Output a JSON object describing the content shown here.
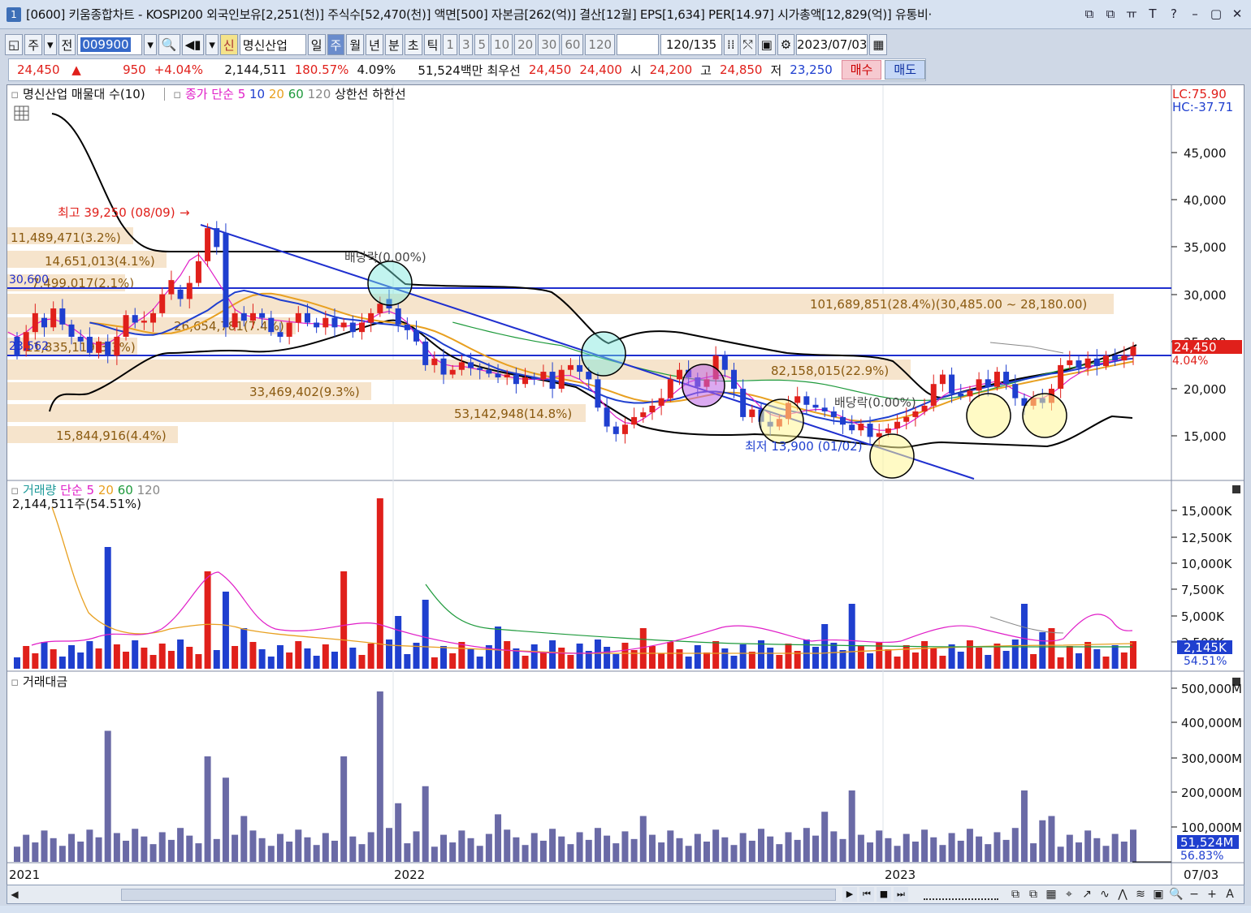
{
  "window": {
    "number": "1",
    "title": "[0600] 키움종합차트 - KOSPI200 외국인보유[2,251(천)] 주식수[52,470(천)] 액면[500] 자본금[262(억)] 결산[12월] EPS[1,634] PER[14.97] 시가총액[12,829(억)] 유통비·",
    "buttons": [
      "⧉",
      "⧉",
      "ㅠ",
      "T",
      "?",
      "–",
      "▢",
      "✕"
    ]
  },
  "toolbar": {
    "items": [
      "◱",
      "주",
      "▾",
      "전"
    ],
    "code": "009900",
    "after": [
      "▾",
      "🔍",
      "◀▮",
      "▾"
    ],
    "badge": "신",
    "name": "명신산업",
    "periods": [
      "일",
      "주",
      "월",
      "년",
      "분",
      "초",
      "틱"
    ],
    "selected_period": "주",
    "nums": [
      "1",
      "3",
      "5",
      "10",
      "20",
      "30",
      "60",
      "120"
    ],
    "count": "120/135",
    "date": "2023/07/03"
  },
  "quote": {
    "price": "24,450",
    "arrow": "▲",
    "change": "950",
    "pct": "+4.04%",
    "volume": "2,144,511",
    "vol_ratio": "180.57%",
    "turnover": "4.09%",
    "amount": "51,524백만",
    "best_label": "최우선",
    "best_ask": "24,450",
    "best_bid": "24,400",
    "open_label": "시",
    "open": "24,200",
    "high_label": "고",
    "high": "24,850",
    "low_label": "저",
    "low": "23,250",
    "buy": "매수",
    "sell": "매도"
  },
  "legend": {
    "main": "명신산업 매물대 수(10)",
    "ma_label": "종가 단순",
    "ma": [
      "5",
      "10",
      "20",
      "60",
      "120"
    ],
    "upper": "상한선",
    "lower": "하한선",
    "vol": "거래량",
    "vol_ma_label": "단순",
    "vol_ma": [
      "5",
      "20",
      "60",
      "120"
    ],
    "vol_info": "2,144,511주(54.51%)",
    "amt": "거래대금"
  },
  "colors": {
    "up": "#e0201b",
    "down": "#1f3fcf",
    "ma5": "#e01ec8",
    "ma10": "#1f3fcf",
    "ma20": "#e8a020",
    "ma60": "#1e9a3c",
    "ma120": "#888888",
    "band": "#000000",
    "vp": "#f6e4cc",
    "vp_text": "#8a5a10"
  },
  "price_axis": {
    "labels": [
      "45,000",
      "40,000",
      "35,000",
      "30,000",
      "25,000",
      "20,000",
      "15,000"
    ],
    "lc": "LC:75.90",
    "hc": "HC:-37.71",
    "last": "24,450",
    "last_pct": "4.04%"
  },
  "vol_axis": {
    "labels": [
      "15,000K",
      "12,500K",
      "10,000K",
      "7,500K",
      "5,000K",
      "2,500K"
    ],
    "last": "2,145K",
    "last_pct": "54.51%"
  },
  "amt_axis": {
    "labels": [
      "500,000M",
      "400,000M",
      "300,000M",
      "200,000M",
      "100,000M"
    ],
    "last": "51,524M",
    "last_pct": "56.83%"
  },
  "x_labels": {
    "y2021": "2021",
    "y2022": "2022",
    "y2023": "2023",
    "end": "07/03"
  },
  "volume_profile": [
    {
      "label": "11,489,471(3.2%)"
    },
    {
      "label": "14,651,013(4.1%)"
    },
    {
      "label": "7,499,017(2.1%)"
    },
    {
      "label": "101,689,851(28.4%)(30,485.00 ~ 28,180.00)"
    },
    {
      "label": "26,654,781(7.4%)"
    },
    {
      "label": "11,835,119(3.3%)"
    },
    {
      "label": "82,158,015(22.9%)"
    },
    {
      "label": "33,469,402(9.3%)"
    },
    {
      "label": "53,142,948(14.8%)"
    },
    {
      "label": "15,844,916(4.4%)"
    }
  ],
  "annotations": {
    "high": "최고 39,250 (08/09)",
    "high_arrow": "→",
    "low": "최저 13,900 (01/02)",
    "div1": "배당락(0.00%)",
    "div2": "배당락(0.00%)",
    "left_price1": "30,600",
    "left_price2": "23,562"
  },
  "chart_data": {
    "type": "candlestick",
    "title": "",
    "weeks": 135,
    "ylim": [
      10000,
      48000
    ],
    "candles": [
      [
        25500,
        23500
      ],
      [
        24000,
        26000
      ],
      [
        26000,
        28000
      ],
      [
        27500,
        26500
      ],
      [
        26500,
        28500
      ],
      [
        28500,
        26800
      ],
      [
        26800,
        25500
      ],
      [
        25500,
        25000
      ],
      [
        25500,
        23800
      ],
      [
        23800,
        25000
      ],
      [
        25000,
        23500
      ],
      [
        23500,
        25500
      ],
      [
        25500,
        27800
      ],
      [
        27800,
        27000
      ],
      [
        27000,
        27200
      ],
      [
        27000,
        28000
      ],
      [
        28000,
        30000
      ],
      [
        30000,
        31500
      ],
      [
        30500,
        29500
      ],
      [
        29500,
        31200
      ],
      [
        31200,
        33500
      ],
      [
        33500,
        37000
      ],
      [
        37000,
        35000
      ],
      [
        36500,
        26500
      ],
      [
        26500,
        28000
      ],
      [
        28000,
        27200
      ],
      [
        27200,
        28000
      ],
      [
        28000,
        27500
      ],
      [
        27500,
        26000
      ],
      [
        26000,
        25500
      ],
      [
        25500,
        27000
      ],
      [
        27000,
        28000
      ],
      [
        28000,
        27000
      ],
      [
        27000,
        26500
      ],
      [
        26500,
        27500
      ],
      [
        27500,
        26500
      ],
      [
        26500,
        27000
      ],
      [
        27000,
        26000
      ],
      [
        26000,
        27000
      ],
      [
        27000,
        28000
      ],
      [
        28000,
        29000
      ],
      [
        29500,
        28500
      ],
      [
        28500,
        26800
      ],
      [
        26800,
        26200
      ],
      [
        26200,
        25000
      ],
      [
        25000,
        22500
      ],
      [
        22500,
        23200
      ],
      [
        23200,
        21500
      ],
      [
        21500,
        22000
      ],
      [
        22000,
        22800
      ],
      [
        22800,
        22200
      ],
      [
        22200,
        22000
      ],
      [
        22000,
        21600
      ],
      [
        21600,
        21200
      ],
      [
        21200,
        21500
      ],
      [
        21500,
        20500
      ],
      [
        20500,
        21200
      ],
      [
        21200,
        21000
      ],
      [
        21000,
        21800
      ],
      [
        21800,
        20000
      ],
      [
        20000,
        22000
      ],
      [
        22000,
        22500
      ],
      [
        22500,
        21800
      ],
      [
        21800,
        21000
      ],
      [
        21000,
        18000
      ],
      [
        18000,
        16000
      ],
      [
        16000,
        15200
      ],
      [
        15200,
        16200
      ],
      [
        16200,
        17000
      ],
      [
        17000,
        17500
      ],
      [
        17500,
        18200
      ],
      [
        18200,
        19000
      ],
      [
        19000,
        21000
      ],
      [
        21000,
        22000
      ],
      [
        22000,
        21200
      ],
      [
        21200,
        20200
      ],
      [
        20200,
        21000
      ],
      [
        21000,
        23500
      ],
      [
        23500,
        22000
      ],
      [
        22000,
        20000
      ],
      [
        20000,
        17000
      ],
      [
        17000,
        17800
      ],
      [
        17800,
        16500
      ],
      [
        16500,
        16000
      ],
      [
        16000,
        16800
      ],
      [
        16800,
        18500
      ],
      [
        18500,
        19200
      ],
      [
        19200,
        18300
      ],
      [
        18300,
        18000
      ],
      [
        18000,
        17600
      ],
      [
        17600,
        17000
      ],
      [
        17000,
        16200
      ],
      [
        16200,
        15600
      ],
      [
        15600,
        16300
      ],
      [
        16300,
        14900
      ],
      [
        14900,
        15300
      ],
      [
        15300,
        15800
      ],
      [
        15800,
        16500
      ],
      [
        16500,
        17000
      ],
      [
        17000,
        17600
      ],
      [
        17600,
        18200
      ],
      [
        18200,
        20500
      ],
      [
        20500,
        21500
      ],
      [
        21500,
        19500
      ],
      [
        19500,
        19200
      ],
      [
        19200,
        19800
      ],
      [
        19800,
        21000
      ],
      [
        21000,
        20200
      ],
      [
        20200,
        21800
      ],
      [
        21800,
        20500
      ],
      [
        20500,
        19000
      ],
      [
        19000,
        18200
      ],
      [
        18200,
        19000
      ],
      [
        19000,
        18500
      ],
      [
        18500,
        20000
      ],
      [
        20000,
        22500
      ],
      [
        22500,
        23000
      ],
      [
        23000,
        22200
      ],
      [
        22200,
        23200
      ],
      [
        23200,
        22400
      ],
      [
        22400,
        23500
      ],
      [
        23500,
        23000
      ],
      [
        23000,
        23500
      ],
      [
        23500,
        24450
      ]
    ],
    "ma5": [
      26000,
      25500,
      26000,
      26800,
      27300,
      27400,
      27000,
      26500,
      25800,
      25000,
      24600,
      24800,
      25400,
      26200,
      27000,
      27600,
      28400,
      29600,
      30800,
      32000,
      33600,
      34200,
      33000,
      31500,
      30000,
      28400,
      27800,
      27600,
      27400,
      27300,
      27200,
      27100,
      27000,
      26900,
      26900,
      26800,
      26700,
      26600,
      26700,
      26900,
      27400,
      28000,
      28200,
      27800,
      27000,
      25600,
      24400,
      23200,
      22600,
      22400,
      22400,
      22200,
      22000,
      21800,
      21600,
      21300,
      21100,
      21000,
      21000,
      21000,
      21200,
      21400,
      21400,
      21000,
      20200,
      19200,
      17900,
      17000,
      16400,
      16300,
      16800,
      17500,
      18200,
      19200,
      20000,
      20700,
      21000,
      21200,
      21400,
      21400,
      21000,
      19800,
      19000,
      18000,
      17300,
      17000,
      17300,
      17500,
      17700,
      17800,
      17800,
      17400,
      17000,
      16500,
      16100,
      15800,
      15600,
      15600,
      15800,
      16200,
      16800,
      17500,
      18300,
      19200,
      19800,
      20000,
      20200,
      20400,
      20600,
      20800,
      20400,
      19800,
      19400,
      19000,
      19000,
      19500,
      20200,
      21000,
      21600,
      22100,
      22600,
      22800,
      23000,
      23200,
      23600
    ],
    "ma10": [
      27000,
      26800,
      26500,
      26200,
      26000,
      25800,
      25700,
      25700,
      25900,
      26300,
      26800,
      27300,
      27800,
      28300,
      29000,
      29600,
      30200,
      30400,
      30200,
      29900,
      29700,
      29400,
      29200,
      29000,
      28700,
      28300,
      27900,
      27600,
      27400,
      27300,
      27200,
      27000,
      26900,
      26800,
      26700,
      26500,
      26200,
      25800,
      25300,
      24700,
      24200,
      23700,
      23300,
      22900,
      22500,
      22100,
      21800,
      21600,
      21400,
      21200,
      21000,
      20900,
      20700,
      20500,
      20300,
      19900,
      19500,
      19100,
      18800,
      18600,
      18500,
      18500,
      18600,
      18700,
      18800,
      19000,
      19300,
      19600,
      19700,
      19700,
      19600,
      19400,
      19100,
      18800,
      18500,
      18200,
      17900,
      17700,
      17500,
      17300,
      17000,
      16800,
      16600,
      16500,
      16400,
      16500,
      16600,
      16800,
      17000,
      17300,
      17600,
      18000,
      18400,
      18800,
      19100,
      19400,
      19600,
      19800,
      20000,
      20200,
      20400,
      20600,
      20800,
      21000,
      21200,
      21400,
      21600,
      21700,
      21900,
      22100,
      22300,
      22500,
      22700,
      22900,
      23100,
      23200
    ]
  }
}
